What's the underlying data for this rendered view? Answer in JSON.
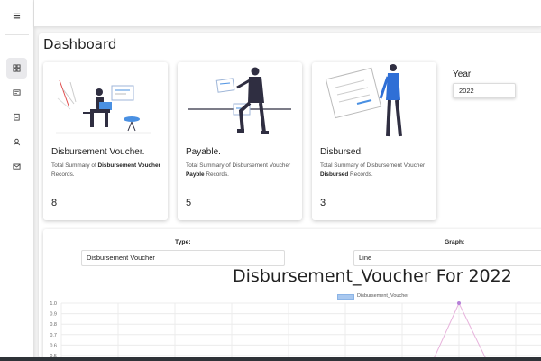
{
  "sidebar": {
    "items": [
      {
        "icon": "menu-icon"
      },
      {
        "icon": "dashboard-icon",
        "active": true
      },
      {
        "icon": "voucher-icon"
      },
      {
        "icon": "clipboard-icon"
      },
      {
        "icon": "user-icon"
      },
      {
        "icon": "mail-icon"
      }
    ]
  },
  "page": {
    "title": "Dashboard"
  },
  "cards": [
    {
      "title": "Disbursement Voucher.",
      "desc_prefix": "Total Summary of ",
      "desc_bold": "Disbursement Voucher",
      "desc_suffix": " Records.",
      "count": "8"
    },
    {
      "title": "Payable.",
      "desc_prefix": "Total Summary of Disbursement Voucher ",
      "desc_bold": "Payble",
      "desc_suffix": " Records.",
      "count": "5"
    },
    {
      "title": "Disbursed.",
      "desc_prefix": "Total Summary of Disbursement Voucher ",
      "desc_bold": "Disbursed",
      "desc_suffix": " Records.",
      "count": "3"
    }
  ],
  "filters": {
    "year_label": "Year",
    "year_value": "2022",
    "type_label": "Type:",
    "type_value": "Disbursement Voucher",
    "graph_label": "Graph:",
    "graph_value": "Line"
  },
  "chart_data": {
    "type": "line",
    "title": "Disbursement_Voucher For 2022",
    "series": [
      {
        "name": "Disbursement_Voucher",
        "peak_value": 1.0
      }
    ],
    "y_ticks": [
      "1.0",
      "0.9",
      "0.8",
      "0.7",
      "0.6",
      "0.5"
    ],
    "ylim": [
      0.5,
      1.0
    ],
    "grid": true,
    "legend_position": "top-center",
    "colors": {
      "legend": "#a9c8ef",
      "line": "#e7b3dc",
      "point": "#b57fd8"
    }
  }
}
